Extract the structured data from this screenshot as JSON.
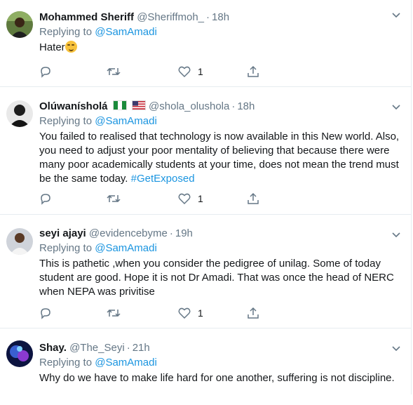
{
  "tweets": [
    {
      "name": "Mohammed Sheriff",
      "handle": "@Sheriffmoh_",
      "time": "18h",
      "reply_prefix": "Replying to",
      "reply_to": "@SamAmadi",
      "text": "Hater",
      "emoji": "smirking-face",
      "like_count": "1",
      "avatar_color": "#3b4a2a"
    },
    {
      "name": "Olúwanísholá",
      "handle": "@shola_olushola",
      "time": "18h",
      "reply_prefix": "Replying to",
      "reply_to": "@SamAmadi",
      "text": "You failed to realised that technology is now available in this New world. Also, you need to adjust your poor mentality of believing that because there were many poor academically students at your time, does not mean the trend must be the same today.",
      "hashtag": "#GetExposed",
      "flags": [
        "nigeria-flag",
        "usa-flag"
      ],
      "like_count": "1",
      "avatar_color": "#2a2a2a"
    },
    {
      "name": "seyi ajayi",
      "handle": "@evidencebyme",
      "time": "19h",
      "reply_prefix": "Replying to",
      "reply_to": "@SamAmadi",
      "text": "This is pathetic ,when you consider the pedigree of unilag. Some of today student are good. Hope it is not Dr Amadi. That was once the head of NERC when NEPA was privitise",
      "like_count": "1",
      "avatar_color": "#d8d8de"
    },
    {
      "name": "Shay.",
      "handle": "@The_Seyi",
      "time": "21h",
      "reply_prefix": "Replying to",
      "reply_to": "@SamAmadi",
      "text": "Why do we have to make life hard for one another, suffering is not discipline.",
      "avatar_color": "#1a2a6a"
    }
  ],
  "colors": {
    "link": "#1b95e0",
    "secondary": "#657786",
    "primary": "#14171a",
    "border": "#e6ecf0"
  },
  "icons": [
    "reply-icon",
    "retweet-icon",
    "like-icon",
    "share-icon",
    "caret-down-icon"
  ]
}
